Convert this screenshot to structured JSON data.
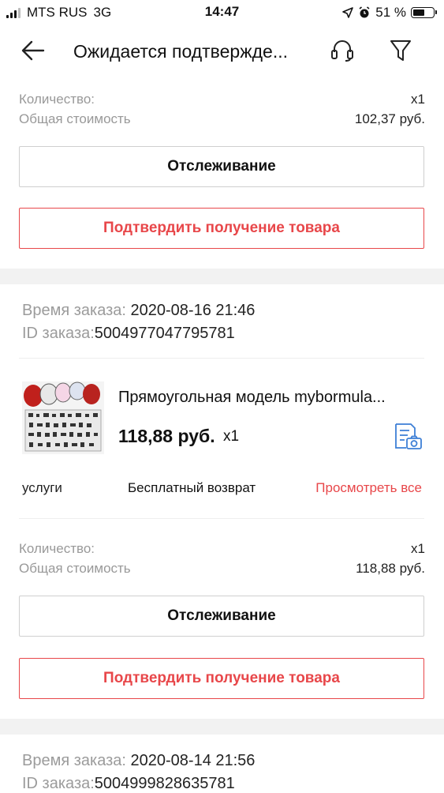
{
  "status_bar": {
    "carrier": "MTS RUS",
    "network": "3G",
    "time": "14:47",
    "battery": "51 %"
  },
  "header": {
    "title": "Ожидается подтвержде...",
    "back_icon": "arrow-left-icon",
    "support_icon": "headset-icon",
    "filter_icon": "funnel-icon"
  },
  "orders": [
    {
      "summary": {
        "qty_label": "Количество:",
        "qty_value": "x1",
        "total_label": "Общая стоимость",
        "total_value": "102,37 руб."
      },
      "track_label": "Отслеживание",
      "confirm_label": "Подтвердить получение товара"
    },
    {
      "time_label": "Время заказа:",
      "time_value": "2020-08-16 21:46",
      "id_label": "ID заказа:",
      "id_value": "5004977047795781",
      "product": {
        "name": "Прямоугольная модель mybormula...",
        "price": "118,88 руб.",
        "qty": "x1"
      },
      "services_label": "услуги",
      "free_return_label": "Бесплатный возврат",
      "view_all_label": "Просмотреть все",
      "summary": {
        "qty_label": "Количество:",
        "qty_value": "x1",
        "total_label": "Общая стоимость",
        "total_value": "118,88 руб."
      },
      "track_label": "Отслеживание",
      "confirm_label": "Подтвердить получение товара"
    },
    {
      "time_label": "Время заказа:",
      "time_value": "2020-08-14 21:56",
      "id_label": "ID заказа:",
      "id_value": "5004999828635781"
    }
  ],
  "colors": {
    "accent_red": "#e8474a",
    "muted_text": "#999999",
    "section_gap": "#f2f2f2"
  }
}
